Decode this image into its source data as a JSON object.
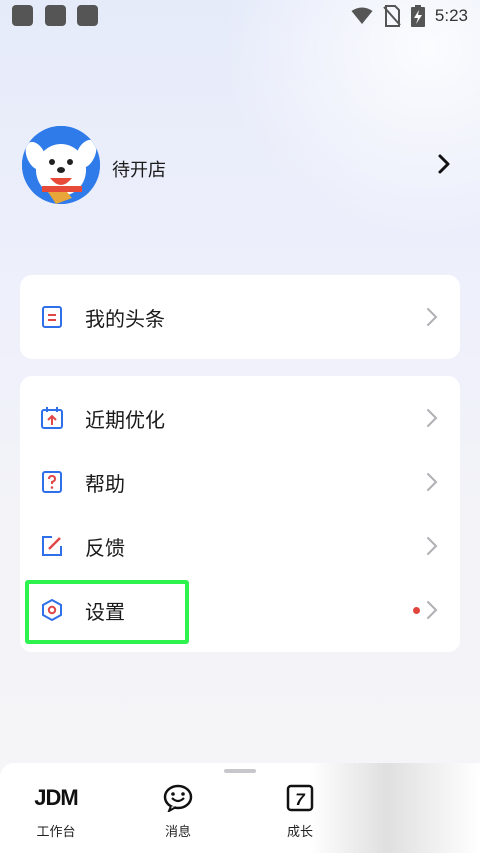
{
  "status_bar": {
    "time": "5:23",
    "icons": [
      "wifi-icon",
      "no-sim-icon",
      "battery-charging-icon"
    ]
  },
  "profile": {
    "shop_name": "待开店",
    "avatar_icon": "jd-dog-mascot-icon"
  },
  "card1": {
    "items": [
      {
        "label": "我的头条",
        "icon": "document-list-icon"
      }
    ]
  },
  "card2": {
    "items": [
      {
        "label": "近期优化",
        "icon": "calendar-upload-icon"
      },
      {
        "label": "帮助",
        "icon": "question-icon"
      },
      {
        "label": "反馈",
        "icon": "edit-icon"
      },
      {
        "label": "设置",
        "icon": "hexagon-settings-icon",
        "has_dot": true
      }
    ]
  },
  "bottom_nav": {
    "items": [
      {
        "label": "工作台",
        "icon_text": "JDM"
      },
      {
        "label": "消息",
        "icon": "chat-smile-icon"
      },
      {
        "label": "成长",
        "icon": "seven-square-icon",
        "icon_text": "7"
      }
    ]
  },
  "colors": {
    "accent_blue": "#2f6fe8",
    "icon_red": "#e04848",
    "dot_red": "#e0463c",
    "highlight_green": "#2ef24e"
  }
}
